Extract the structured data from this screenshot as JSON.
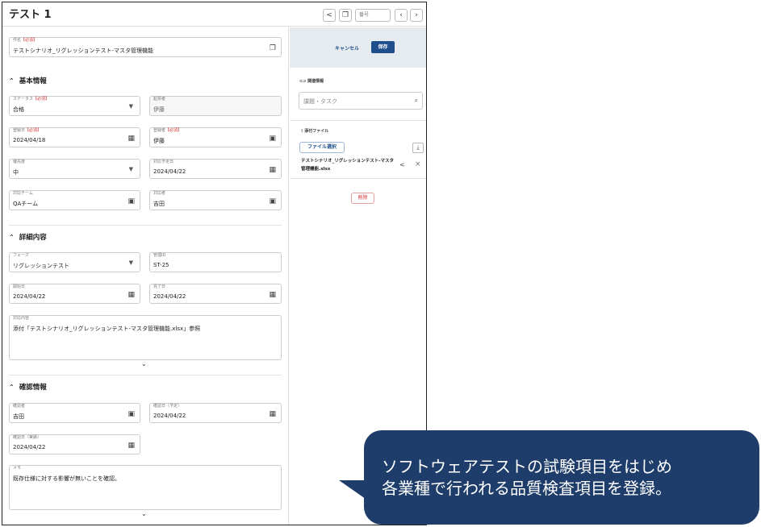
{
  "window": {
    "title": "テスト 1",
    "number_placeholder": "番号",
    "share_icon": "share-icon",
    "copy_icon": "copy-icon",
    "prev_icon": "chevron-left-icon",
    "next_icon": "chevron-right-icon"
  },
  "required_mark": "【必須】",
  "item_name": {
    "label": "件名",
    "value": "テストシナリオ_リグレッションテスト-マスタ管理機能"
  },
  "basic": {
    "heading": "基本情報",
    "status": {
      "label": "ステータス",
      "value": "合格"
    },
    "author": {
      "label": "起票者",
      "value": "伊藤"
    },
    "reg_date": {
      "label": "登録日",
      "value": "2024/04/18"
    },
    "registrant": {
      "label": "登録者",
      "value": "伊藤"
    },
    "priority": {
      "label": "優先度",
      "value": "中"
    },
    "due_date": {
      "label": "対応予定日",
      "value": "2024/04/22"
    },
    "team": {
      "label": "対応チーム",
      "value": "QAチーム"
    },
    "assignee": {
      "label": "対応者",
      "value": "吉田"
    }
  },
  "detail": {
    "heading": "詳細内容",
    "phase": {
      "label": "フェーズ",
      "value": "リグレッションテスト"
    },
    "manage_id": {
      "label": "管理ID",
      "value": "ST-25"
    },
    "start": {
      "label": "開始日",
      "value": "2024/04/22"
    },
    "end": {
      "label": "完了日",
      "value": "2024/04/22"
    },
    "content": {
      "label": "対応内容",
      "value": "添付「テストシナリオ_リグレッションテスト-マスタ管理機能.xlsx」参照"
    }
  },
  "confirm": {
    "heading": "確認情報",
    "confirmer": {
      "label": "確認者",
      "value": "吉田"
    },
    "planned": {
      "label": "確認日（予定）",
      "value": "2024/04/22"
    },
    "actual": {
      "label": "確認日（実績）",
      "value": "2024/04/22"
    },
    "memo": {
      "label": "メモ",
      "value": "既存仕様に対する影響が無いことを確認。"
    }
  },
  "side": {
    "cancel": "キャンセル",
    "save": "保存",
    "related_title": "関連情報",
    "search_placeholder": "課題・タスク",
    "attach_title": "添付ファイル",
    "file_select": "ファイル選択",
    "file_name": "テストシナリオ_リグレッションテスト-マスタ管理機能.xlsx",
    "delete": "削除"
  },
  "callout": {
    "line1": "ソフトウェアテストの試験項目をはじめ",
    "line2": "各業種で行われる品質検査項目を登録。"
  },
  "colors": {
    "accent": "#1f4e8c",
    "required": "#d32f2f",
    "callout_bg": "#1e3d6a"
  }
}
